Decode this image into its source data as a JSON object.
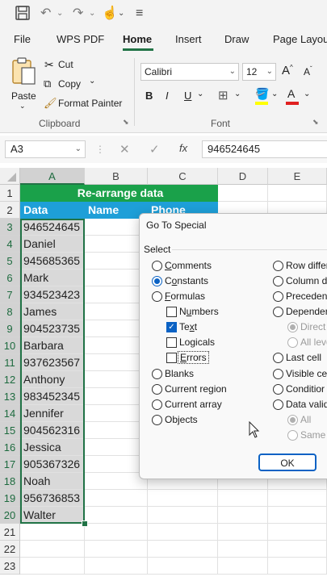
{
  "tabs": [
    "File",
    "WPS PDF",
    "Home",
    "Insert",
    "Draw",
    "Page Layou"
  ],
  "active_tab": "Home",
  "clipboard": {
    "paste_label": "Paste",
    "cut_label": "Cut",
    "copy_label": "Copy",
    "format_painter_label": "Format Painter",
    "group_label": "Clipboard"
  },
  "font": {
    "name": "Calibri",
    "size": "12",
    "group_label": "Font",
    "bold": "B",
    "italic": "I",
    "underline": "U",
    "font_color_glyph": "A"
  },
  "formula_bar": {
    "name_box": "A3",
    "fx": "fx",
    "value": "946524645"
  },
  "columns": [
    "A",
    "B",
    "C",
    "D",
    "E"
  ],
  "rows": [
    "1",
    "2",
    "3",
    "4",
    "5",
    "6",
    "7",
    "8",
    "9",
    "10",
    "11",
    "12",
    "13",
    "14",
    "15",
    "16",
    "17",
    "18",
    "19",
    "20",
    "21",
    "22",
    "23"
  ],
  "sheet": {
    "title": "Re-arrange data",
    "headers": [
      "Data",
      "Name",
      "Phone"
    ],
    "column_a": [
      "946524645",
      "Daniel",
      "945685365",
      "Mark",
      "934523423",
      "James",
      "904523735",
      "Barbara",
      "937623567",
      "Anthony",
      "983452345",
      "Jennifer",
      "904562316",
      "Jessica",
      "905367326",
      "Noah",
      "956736853",
      "Walter"
    ]
  },
  "dialog": {
    "title": "Go To Special",
    "select_label": "Select",
    "left_options": [
      {
        "label": "Comments",
        "key": "C",
        "rest": "omments",
        "checked": false
      },
      {
        "label": "Constants",
        "key": "o",
        "pre": "C",
        "rest": "nstants",
        "checked": true
      },
      {
        "label": "Formulas",
        "key": "F",
        "rest": "ormulas",
        "checked": false
      }
    ],
    "formula_subs": [
      {
        "label": "Numbers",
        "key": "u",
        "pre": "N",
        "rest": "mbers",
        "checked": false
      },
      {
        "label": "Text",
        "key": "x",
        "pre": "Te",
        "rest": "t",
        "checked": true
      },
      {
        "label": "Logicals",
        "key": "g",
        "pre": "Lo",
        "rest": "icals",
        "checked": false
      },
      {
        "label": "Errors",
        "key": "E",
        "rest": "rrors",
        "checked": false
      }
    ],
    "left_options2": [
      "Blanks",
      "Current region",
      "Current array",
      "Objects"
    ],
    "right_options": [
      "Row differ",
      "Column di",
      "Precedent",
      "Depender"
    ],
    "right_subs1": [
      "Direct",
      "All leve"
    ],
    "right_options2": [
      "Last cell",
      "Visible ce",
      "Conditior",
      "Data valid"
    ],
    "right_subs2": [
      "All",
      "Same"
    ],
    "ok_label": "OK"
  },
  "colors": {
    "accent": "#217346",
    "title_fill": "#1aa14a",
    "header_fill": "#1e9fd8",
    "dialog_accent": "#0b62c4"
  }
}
